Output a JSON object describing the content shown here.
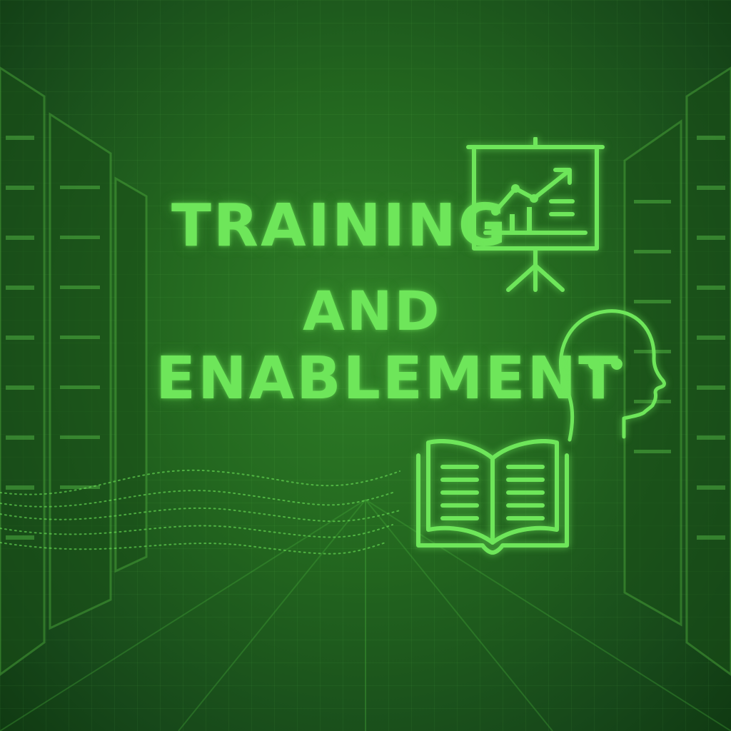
{
  "title": {
    "line1": "TRAINING",
    "line2": "AND",
    "line3": "ENABLEMENT"
  },
  "icons": [
    "presentation-board-icon",
    "human-head-icon",
    "open-book-icon"
  ],
  "colors": {
    "background": "#23671f",
    "accent": "#6ee65a"
  }
}
